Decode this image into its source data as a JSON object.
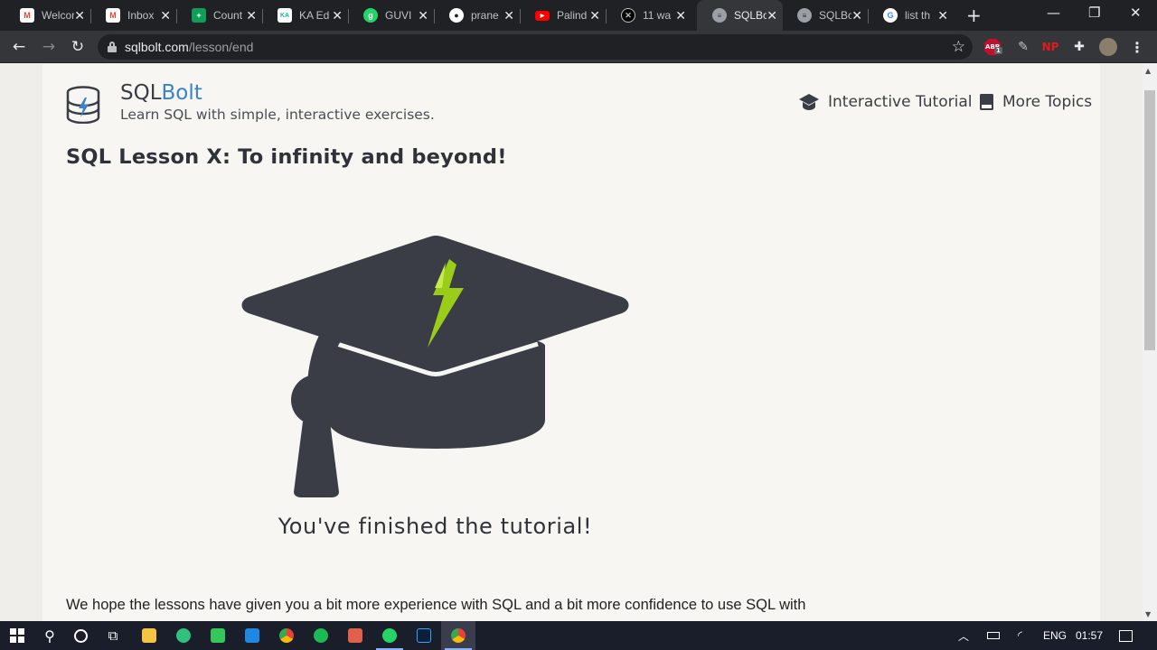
{
  "tabs": [
    {
      "title": "Welcome",
      "icon": "gmail-icon",
      "color": "#ea4335"
    },
    {
      "title": "Inbox",
      "icon": "gmail-icon",
      "color": "#ea4335"
    },
    {
      "title": "Count",
      "icon": "sheets-icon",
      "color": "#0f9d58"
    },
    {
      "title": "KA Ed",
      "icon": "khan-academy-icon",
      "color": "#ffffff"
    },
    {
      "title": "GUVI",
      "icon": "guvi-icon",
      "color": "#25d366"
    },
    {
      "title": "prane",
      "icon": "github-icon",
      "color": "#ffffff"
    },
    {
      "title": "Palind",
      "icon": "youtube-icon",
      "color": "#ff0000"
    },
    {
      "title": "11 wa",
      "icon": "circle-x-icon",
      "color": "#000000"
    },
    {
      "title": "SQLBolt",
      "icon": "database-icon",
      "color": "#9aa0a6"
    },
    {
      "title": "SQLBolt",
      "icon": "database-icon",
      "color": "#9aa0a6"
    },
    {
      "title": "list th",
      "icon": "google-icon",
      "color": "#4285f4"
    }
  ],
  "active_tab_index": 8,
  "address_bar": {
    "host": "sqlbolt.com",
    "path": "/lesson/end"
  },
  "extensions": {
    "abp_label": "ABP",
    "abp_badge": "1",
    "np_label": "NP"
  },
  "site": {
    "brand_sql": "SQL",
    "brand_bolt": "Bolt",
    "tagline": "Learn SQL with simple, interactive exercises.",
    "nav_tutorial": "Interactive Tutorial",
    "nav_topics": "More Topics"
  },
  "lesson": {
    "title": "SQL Lesson X: To infinity and beyond!",
    "finished": "You've finished the tutorial!",
    "paragraph": "We hope the lessons have given you a bit more experience with SQL and a bit more confidence to use SQL with your own data."
  },
  "colors": {
    "brand_blue": "#3b82c6",
    "cap_dark": "#3a3d45",
    "bolt_green": "#9acd1a"
  },
  "taskbar": {
    "apps": [
      "start-icon",
      "search-icon",
      "cortana-icon",
      "task-view-icon",
      "file-explorer-icon",
      "app-icon",
      "app-icon",
      "vscode-icon",
      "chrome-icon",
      "spotify-icon",
      "app-icon",
      "whatsapp-icon",
      "photoshop-icon",
      "chrome-icon"
    ],
    "language": "ENG",
    "time": "01:57"
  }
}
